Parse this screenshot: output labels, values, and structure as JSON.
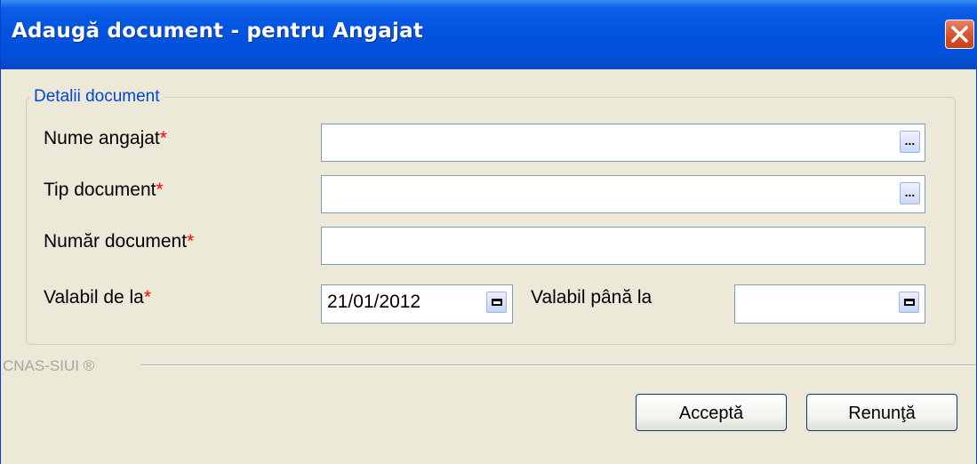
{
  "window": {
    "title": "Adaugă document - pentru Angajat"
  },
  "group": {
    "legend": "Detalii document"
  },
  "fields": {
    "nume_angajat": {
      "label": "Nume angajat",
      "required_marker": "*",
      "value": ""
    },
    "tip_document": {
      "label": "Tip document",
      "required_marker": "*",
      "value": ""
    },
    "numar_document": {
      "label": "Număr document",
      "required_marker": "*",
      "value": ""
    },
    "valabil_de_la": {
      "label": "Valabil de la",
      "required_marker": "*",
      "value": "21/01/2012"
    },
    "valabil_pana_la": {
      "label": "Valabil până la",
      "value": ""
    }
  },
  "picker_button_label": "...",
  "footer": {
    "brand": "CNAS-SIUI ®"
  },
  "buttons": {
    "accept": "Acceptă",
    "cancel": "Renunţă"
  },
  "colors": {
    "title_bar": "#0254e0",
    "legend_text": "#0046d5",
    "required": "#ff0000",
    "close_button": "#d9542f"
  }
}
